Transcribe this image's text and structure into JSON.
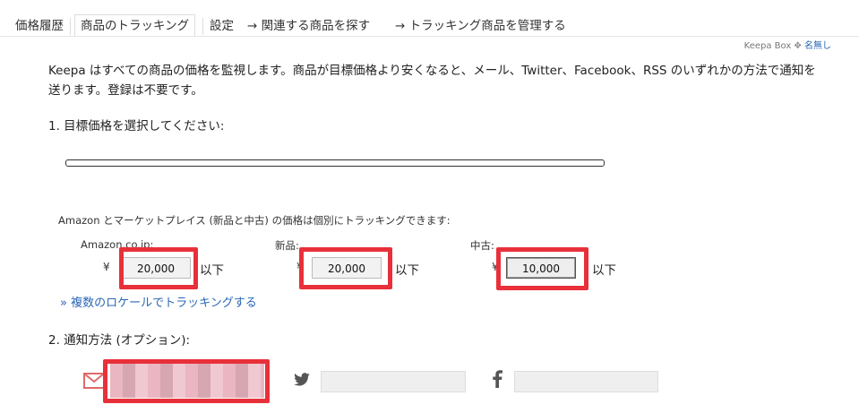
{
  "tabs": {
    "price_history": "価格履歴",
    "tracking": "商品のトラッキング",
    "settings": "設定",
    "find_related": "→ 関連する商品を探す",
    "manage_tracking": "→ トラッキング商品を管理する"
  },
  "keepa_box": {
    "label": "Keepa Box",
    "user": "名無し"
  },
  "intro": {
    "line1": "Keepa はすべての商品の価格を監視します。商品が目標価格より安くなると、メール、Twitter、Facebook、RSS のいずれかの方法で通知を",
    "line2": "送ります。登録は不要です。"
  },
  "step1": {
    "label": "1. 目標価格を選択してください:"
  },
  "price_note": "Amazon とマーケットプレイス (新品と中古) の価格は個別にトラッキングできます:",
  "prices": [
    {
      "label": "Amazon.co.jp:",
      "currency": "¥",
      "value": "20,000",
      "suffix": "以下"
    },
    {
      "label": "新品:",
      "currency": "¥",
      "value": "20,000",
      "suffix": "以下"
    },
    {
      "label": "中古:",
      "currency": "¥",
      "value": "10,000",
      "suffix": "以下"
    }
  ],
  "locale_link": "» 複数のロケールでトラッキングする",
  "step2": {
    "label": "2. 通知方法 (オプション):"
  },
  "colors": {
    "highlight": "#e8303a",
    "link": "#2a67b7"
  }
}
